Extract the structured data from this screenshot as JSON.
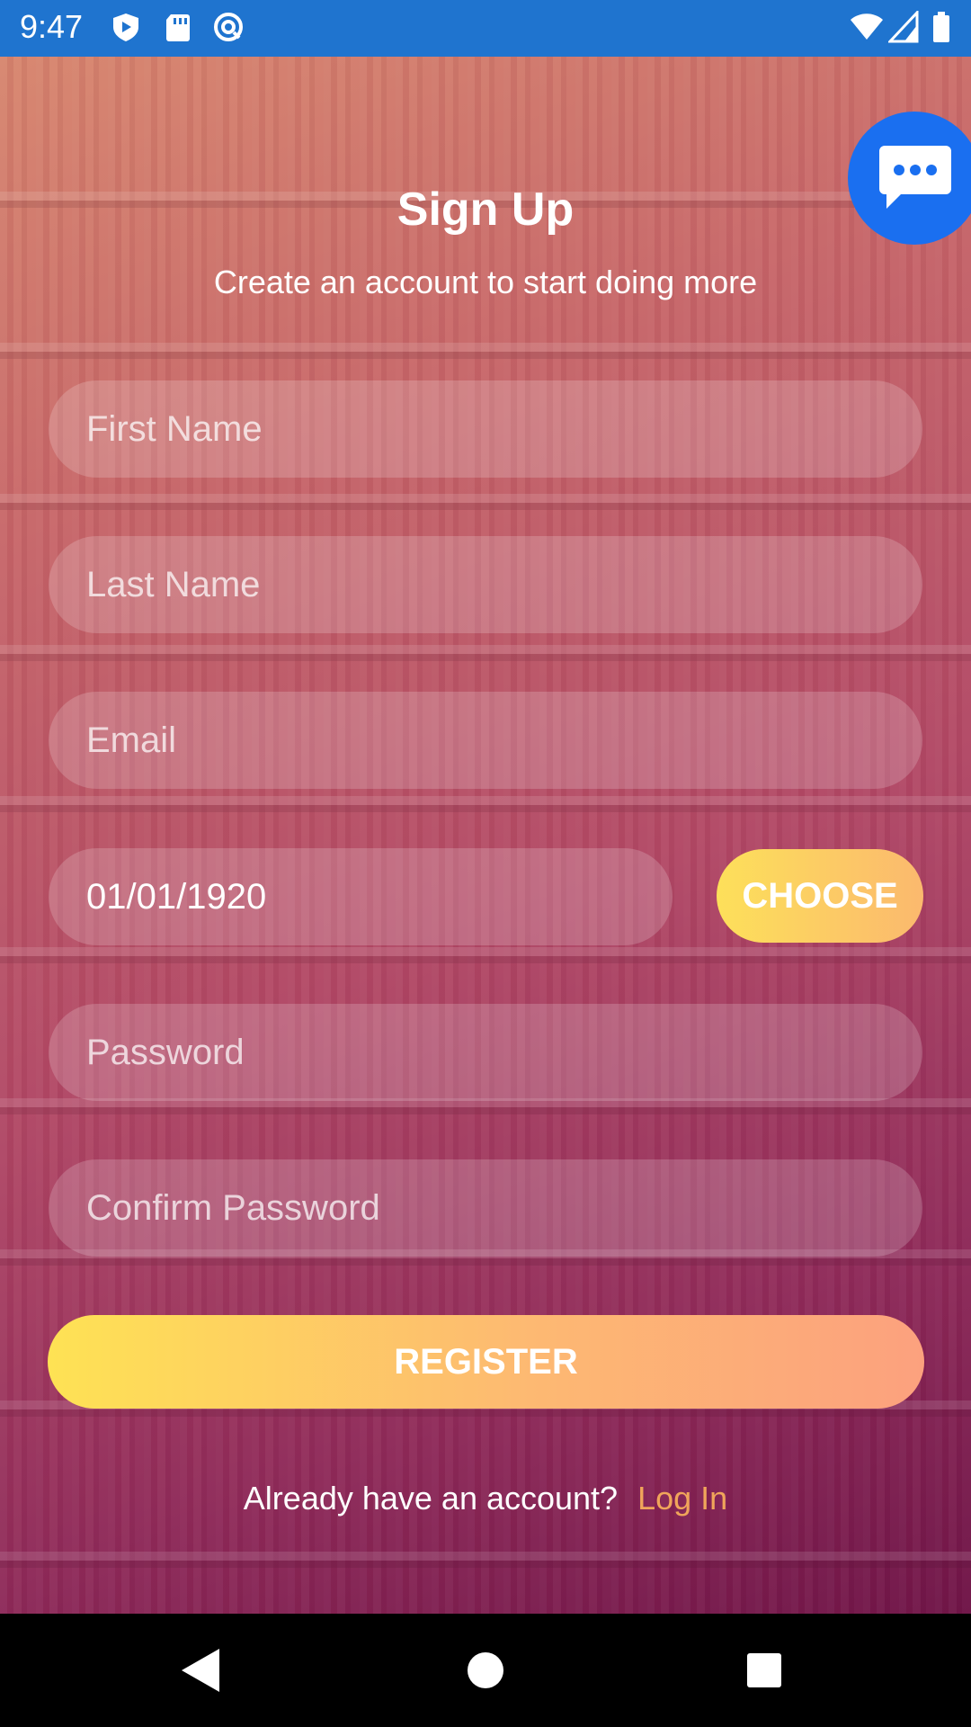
{
  "status_bar": {
    "time": "9:47",
    "left_icons": [
      "play-shield-icon",
      "sd-card-icon",
      "at-sign-icon"
    ],
    "right_icons": [
      "wifi-icon",
      "signal-icon",
      "battery-icon"
    ]
  },
  "colors": {
    "status_bar": "#1f74cf",
    "fab": "#1a6ff0",
    "button_gradient_start": "#fee254",
    "button_gradient_end": "#fca17e",
    "login_link": "#f0a55a"
  },
  "header": {
    "title": "Sign Up",
    "subtitle": "Create an account to start doing more"
  },
  "form": {
    "first_name": {
      "placeholder": "First Name",
      "value": ""
    },
    "last_name": {
      "placeholder": "Last Name",
      "value": ""
    },
    "email": {
      "placeholder": "Email",
      "value": ""
    },
    "birth_date": {
      "value": "01/01/1920"
    },
    "choose_label": "CHOOSE",
    "password": {
      "placeholder": "Password",
      "value": ""
    },
    "confirm_password": {
      "placeholder": "Confirm Password",
      "value": ""
    },
    "register_label": "REGISTER"
  },
  "footer": {
    "prompt": "Already have an account?",
    "login_link": "Log In"
  },
  "fab": {
    "icon": "chat-bubble-icon"
  },
  "nav_bar": {
    "icons": [
      "back-icon",
      "home-icon",
      "recents-icon"
    ]
  }
}
